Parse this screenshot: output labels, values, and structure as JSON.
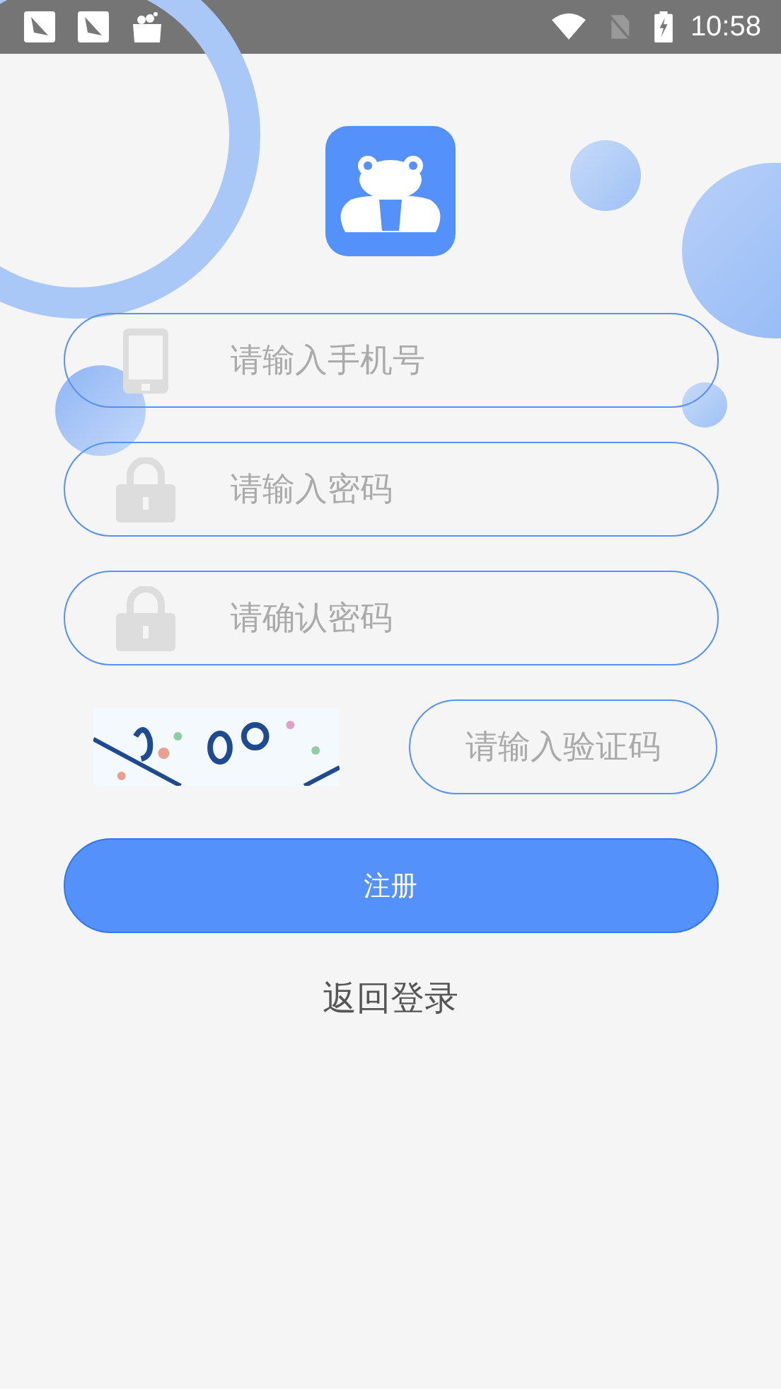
{
  "status_bar": {
    "time": "10:58"
  },
  "fields": [
    {
      "kind": "phone",
      "placeholder": "请输入手机号"
    },
    {
      "kind": "lock",
      "placeholder": "请输入密码"
    },
    {
      "kind": "lock",
      "placeholder": "请确认密码"
    }
  ],
  "captcha": {
    "kind": "picture",
    "placeholder": "请输入验证码"
  },
  "register_button": "注册",
  "back_link": "返回登录"
}
